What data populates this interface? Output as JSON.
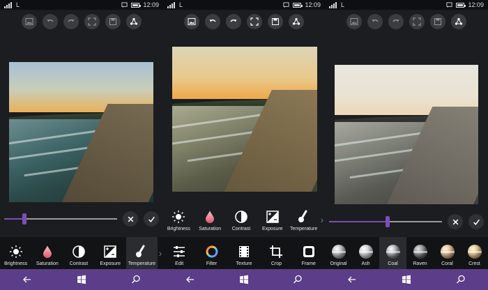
{
  "status": {
    "time": "12:09",
    "carrier_glyph": "L"
  },
  "toolbar": {
    "icons": [
      "image-icon",
      "undo-icon",
      "redo-icon",
      "fullscreen-icon",
      "save-icon",
      "share-icon"
    ]
  },
  "adjust_tools": [
    {
      "label": "Brightness",
      "icon": "sun-icon"
    },
    {
      "label": "Saturation",
      "icon": "drop-icon"
    },
    {
      "label": "Contrast",
      "icon": "contrast-icon"
    },
    {
      "label": "Exposure",
      "icon": "exposure-icon"
    },
    {
      "label": "Temperature",
      "icon": "thermometer-icon"
    }
  ],
  "main_tools": [
    {
      "label": "Edit",
      "icon": "sliders-icon"
    },
    {
      "label": "Filter",
      "icon": "color-wheel-icon"
    },
    {
      "label": "Texture",
      "icon": "film-icon"
    },
    {
      "label": "Crop",
      "icon": "crop-icon"
    },
    {
      "label": "Frame",
      "icon": "frame-icon"
    }
  ],
  "filters": [
    {
      "label": "Original",
      "style": "original"
    },
    {
      "label": "Ash",
      "style": "ash"
    },
    {
      "label": "Coal",
      "style": "coal"
    },
    {
      "label": "Raven",
      "style": "raven"
    },
    {
      "label": "Coral",
      "style": "coral"
    },
    {
      "label": "Crest",
      "style": "crest"
    }
  ],
  "screen1": {
    "slider_value": 0.18,
    "active_tool": "Temperature"
  },
  "screen3": {
    "slider_value": 0.52,
    "active_filter": "Coal"
  },
  "colors": {
    "accent": "#7b4fb5",
    "navbar": "#5b3d89",
    "background": "#1b1d20"
  }
}
